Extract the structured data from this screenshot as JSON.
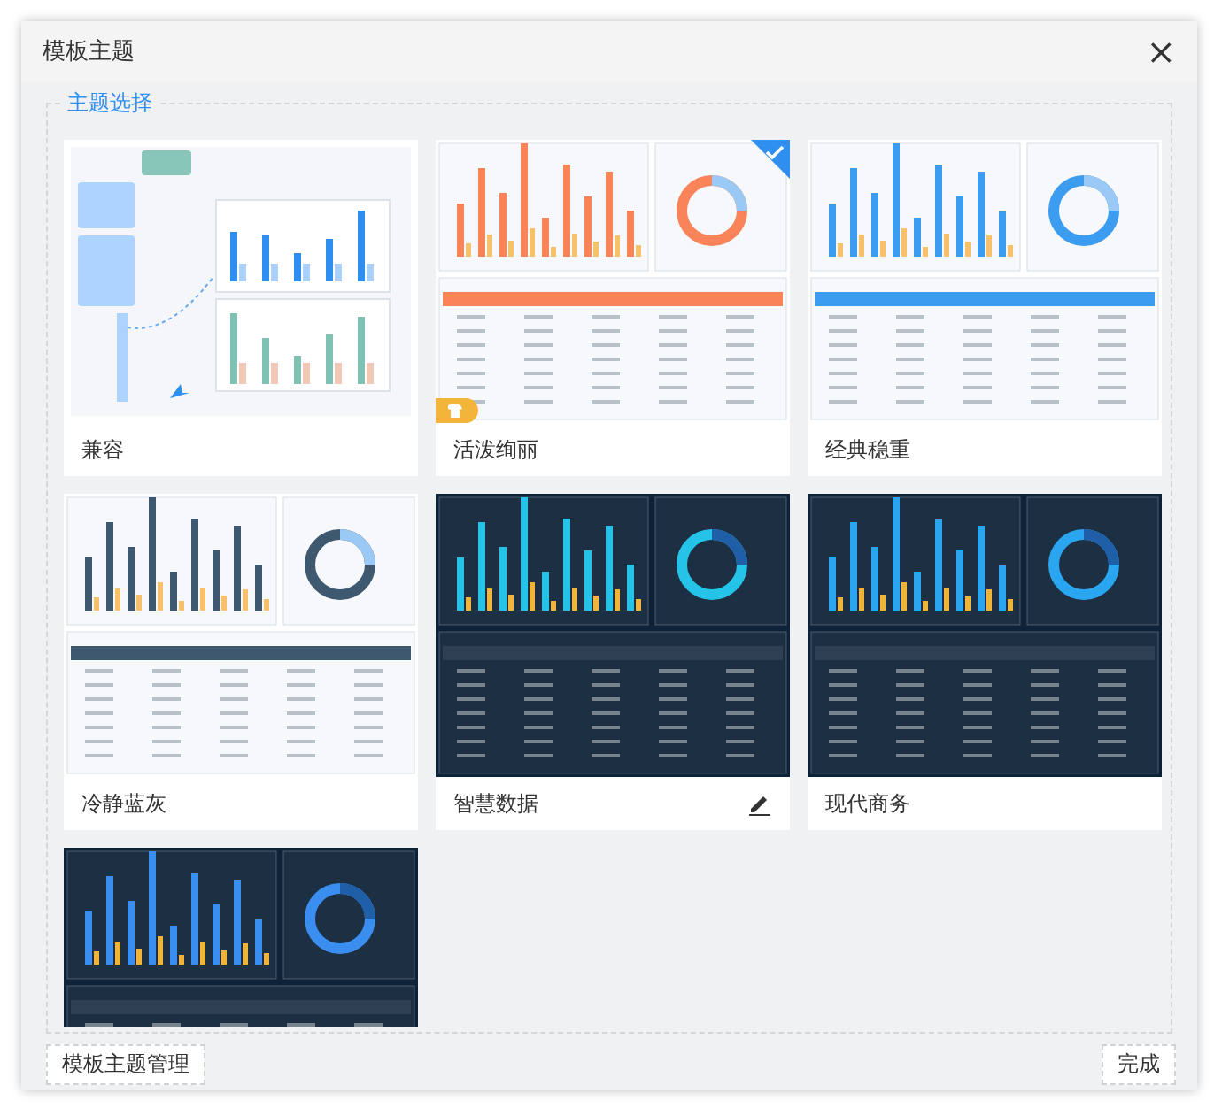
{
  "dialog": {
    "title": "模板主题",
    "close": "×"
  },
  "section": {
    "legend": "主题选择"
  },
  "themes": [
    {
      "label": "兼容",
      "kind": "illustration",
      "color": "#2f8ff0",
      "selected": false,
      "in_use": false,
      "editable": false
    },
    {
      "label": "活泼绚丽",
      "kind": "light",
      "color": "#f9845a",
      "selected": true,
      "in_use": true,
      "editable": false
    },
    {
      "label": "经典稳重",
      "kind": "light",
      "color": "#3c9cf0",
      "selected": false,
      "in_use": false,
      "editable": false
    },
    {
      "label": "冷静蓝灰",
      "kind": "light",
      "color": "#3e5870",
      "selected": false,
      "in_use": false,
      "editable": false
    },
    {
      "label": "智慧数据",
      "kind": "dark",
      "color": "#26c3e8",
      "selected": false,
      "in_use": false,
      "editable": true
    },
    {
      "label": "现代商务",
      "kind": "dark",
      "color": "#2aa6f0",
      "selected": false,
      "in_use": false,
      "editable": false
    },
    {
      "kind": "dark",
      "color": "#3a8ef0",
      "selected": false,
      "in_use": false,
      "editable": false
    }
  ],
  "footer": {
    "manage": "模板主题管理",
    "done": "完成"
  }
}
